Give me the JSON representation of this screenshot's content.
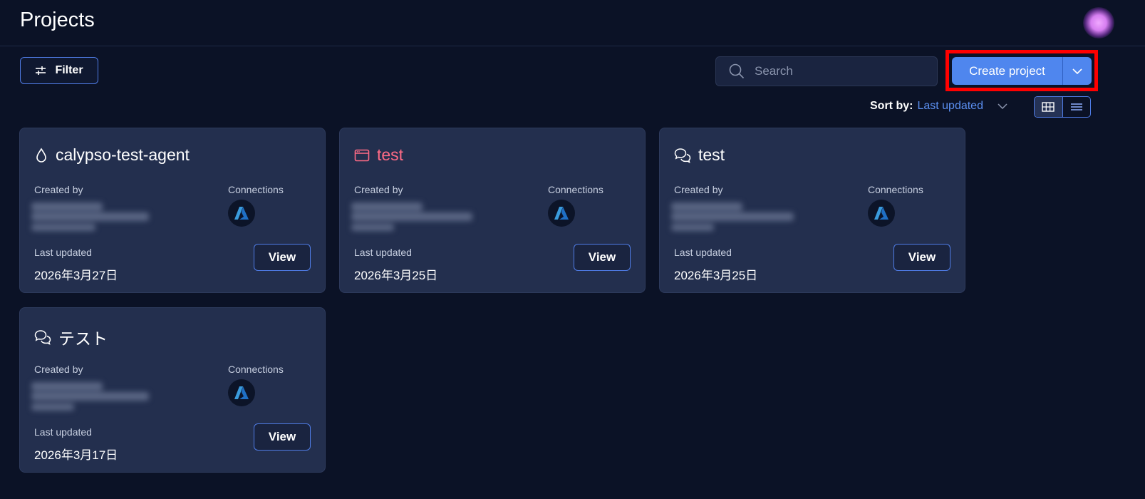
{
  "header": {
    "title": "Projects"
  },
  "toolbar": {
    "filter_label": "Filter",
    "search_placeholder": "Search",
    "create_label": "Create project",
    "sort_label": "Sort by:",
    "sort_value": "Last updated"
  },
  "labels": {
    "created_by": "Created by",
    "connections": "Connections",
    "last_updated": "Last updated",
    "view": "View"
  },
  "projects": [
    {
      "name": "calypso-test-agent",
      "icon": "drop-icon",
      "date": "2026年3月27日",
      "title_color": "#ffffff",
      "connection": "azure-icon"
    },
    {
      "name": "test",
      "icon": "window-icon",
      "date": "2026年3月25日",
      "title_color": "#ff6b86",
      "connection": "azure-icon"
    },
    {
      "name": "test",
      "icon": "chat-icon",
      "date": "2026年3月25日",
      "title_color": "#ffffff",
      "connection": "azure-icon"
    },
    {
      "name": "テスト",
      "icon": "chat-icon",
      "date": "2026年3月17日",
      "title_color": "#ffffff",
      "connection": "azure-icon"
    }
  ],
  "colors": {
    "background": "#0b1226",
    "card": "#232f4e",
    "accent": "#4f86ee",
    "link": "#5b8ff0"
  }
}
